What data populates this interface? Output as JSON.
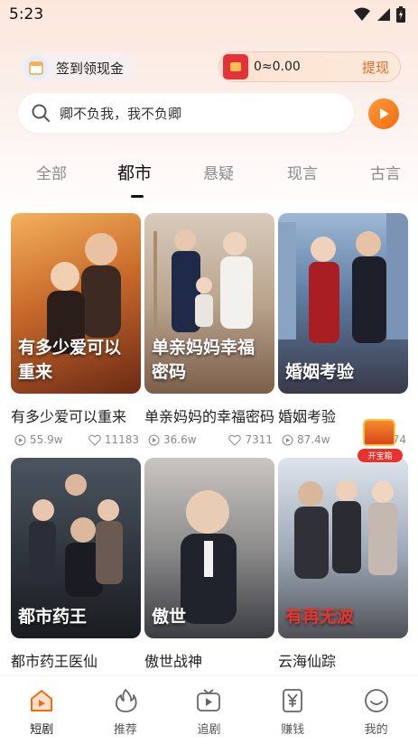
{
  "status_bar": {
    "time": "5:23"
  },
  "rewards": {
    "signin_label": "签到领现金",
    "cash_amount": "0≈0.00",
    "withdraw_label": "提现"
  },
  "search": {
    "text": "卿不负我，我不负卿"
  },
  "tabs": [
    {
      "label": "全部",
      "active": false
    },
    {
      "label": "都市",
      "active": true
    },
    {
      "label": "悬疑",
      "active": false
    },
    {
      "label": "现言",
      "active": false
    },
    {
      "label": "古言",
      "active": false
    }
  ],
  "cards": [
    {
      "title": "有多少爱可以重来",
      "poster_text": "有多少爱可以重来",
      "views": "55.9w",
      "likes": "11183"
    },
    {
      "title": "单亲妈妈的幸福密码",
      "poster_text": "单亲妈妈幸福密码",
      "views": "36.6w",
      "likes": "7311"
    },
    {
      "title": "婚姻考验",
      "poster_text": "婚姻考验",
      "views": "87.4w",
      "likes": "474"
    },
    {
      "title": "都市药王医仙",
      "poster_text": "都市药王",
      "views": "",
      "likes": ""
    },
    {
      "title": "傲世战神",
      "poster_text": "傲世",
      "views": "",
      "likes": ""
    },
    {
      "title": "云海仙踪",
      "poster_text": "有再无波",
      "views": "",
      "likes": ""
    }
  ],
  "treasure": {
    "label": "开宝箱"
  },
  "bottom_nav": [
    {
      "label": "短剧",
      "icon": "home-tv-icon",
      "active": true
    },
    {
      "label": "推荐",
      "icon": "flame-icon",
      "active": false
    },
    {
      "label": "追剧",
      "icon": "tv-play-icon",
      "active": false
    },
    {
      "label": "赚钱",
      "icon": "yen-wallet-icon",
      "active": false
    },
    {
      "label": "我的",
      "icon": "smile-face-icon",
      "active": false
    }
  ],
  "colors": {
    "accent": "#f36b10",
    "withdraw": "#e36b23",
    "nav_active": "#f36b10"
  }
}
